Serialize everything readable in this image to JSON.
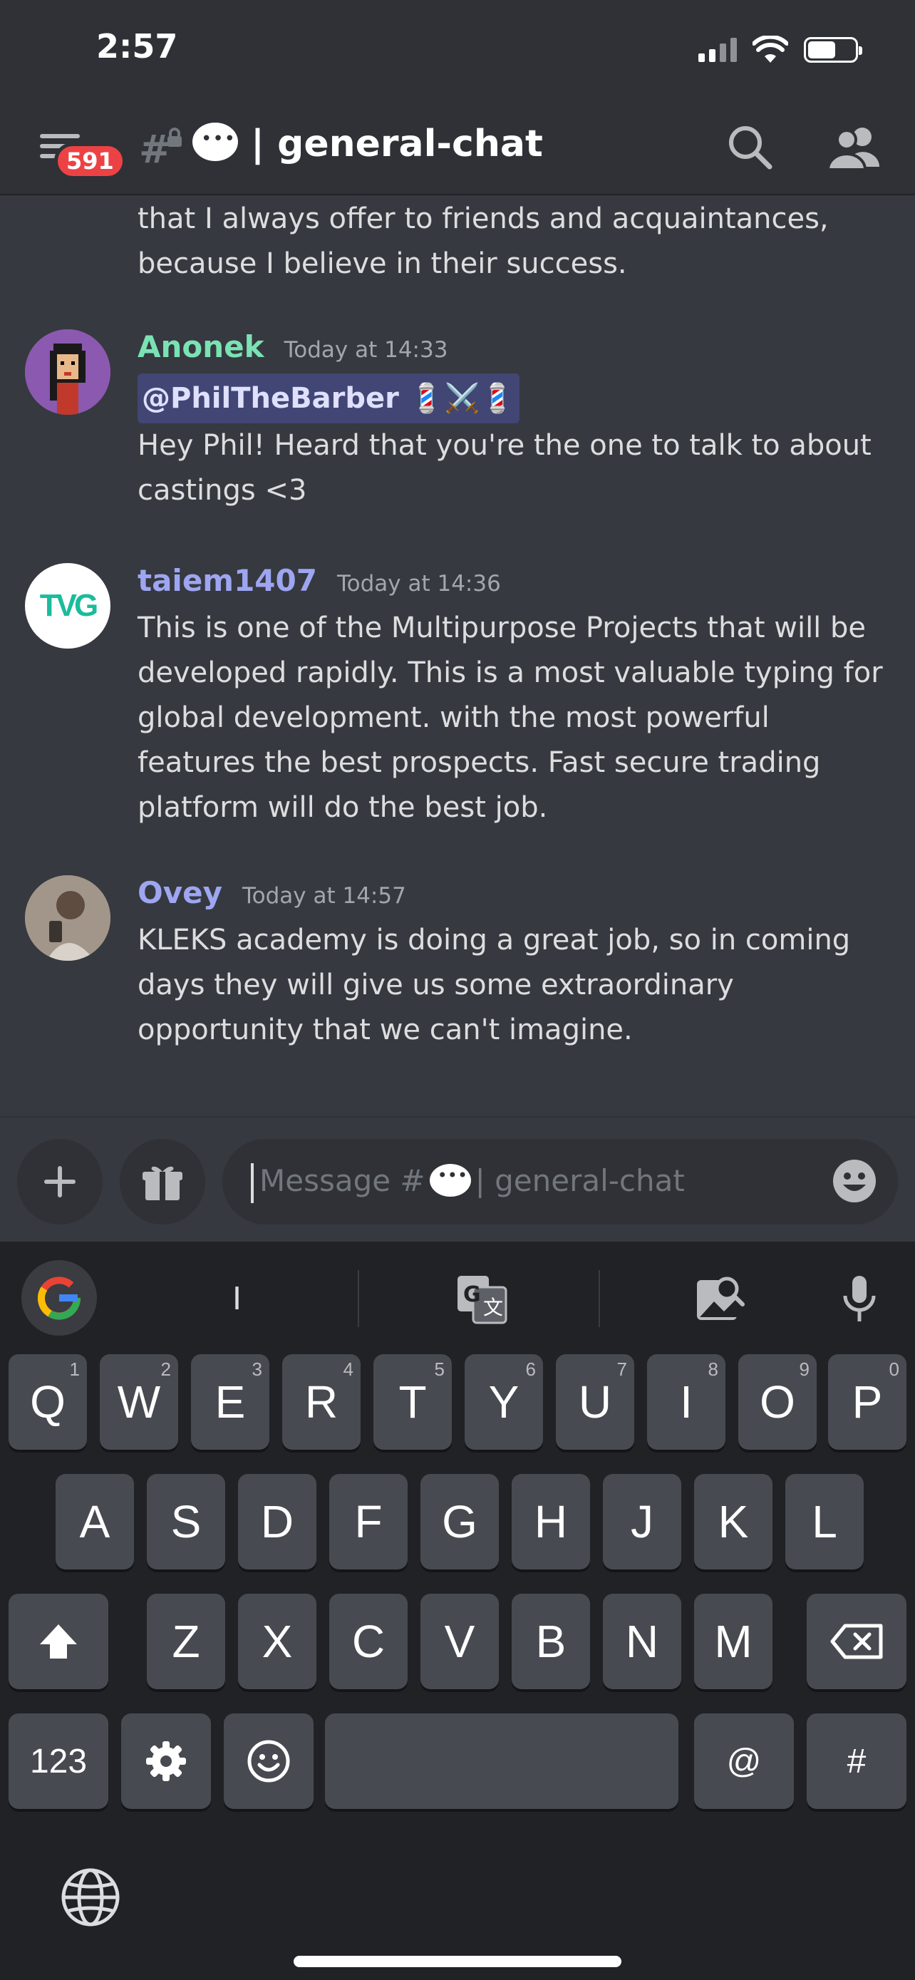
{
  "status": {
    "time": "2:57"
  },
  "header": {
    "badge_count": "591",
    "channel_name": "| general-chat",
    "hash_symbol": "#"
  },
  "messages": {
    "continuation": "that I always offer to friends and acquaintances, because I believe in their success.",
    "items": [
      {
        "author": "Anonek",
        "author_color": "#7be2b4",
        "timestamp": "Today at 14:33",
        "mention": "@PhilTheBarber 💈⚔️💈",
        "text": "Hey Phil! Heard that you're the one to talk to about castings <3"
      },
      {
        "author": "taiem1407",
        "author_color": "#9ea6f2",
        "timestamp": "Today at 14:36",
        "text": "This is one of the Multipurpose Projects that will be developed rapidly. This is a most valuable typing for global development. with the most powerful features the best prospects. Fast secure trading platform will do the best job."
      },
      {
        "author": "Ovey",
        "author_color": "#9ea6f2",
        "timestamp": "Today at 14:57",
        "text": "KLEKS academy is doing a great job, so in coming days they will give us some extraordinary opportunity that we can't imagine."
      }
    ],
    "avatar_tvg_text": "TVG"
  },
  "composer": {
    "placeholder_prefix": "Message #",
    "placeholder_suffix": "| general-chat"
  },
  "keyboard": {
    "suggestion": "I",
    "row1": [
      {
        "k": "Q",
        "n": "1"
      },
      {
        "k": "W",
        "n": "2"
      },
      {
        "k": "E",
        "n": "3"
      },
      {
        "k": "R",
        "n": "4"
      },
      {
        "k": "T",
        "n": "5"
      },
      {
        "k": "Y",
        "n": "6"
      },
      {
        "k": "U",
        "n": "7"
      },
      {
        "k": "I",
        "n": "8"
      },
      {
        "k": "O",
        "n": "9"
      },
      {
        "k": "P",
        "n": "0"
      }
    ],
    "row2": [
      "A",
      "S",
      "D",
      "F",
      "G",
      "H",
      "J",
      "K",
      "L"
    ],
    "row3": [
      "Z",
      "X",
      "C",
      "V",
      "B",
      "N",
      "M"
    ],
    "numbers_label": "123",
    "at_label": "@",
    "hash_label": "#"
  },
  "colors": {
    "background": "#36393f",
    "header": "#2f3136",
    "badge": "#ed4245",
    "mention_bg": "#414675"
  }
}
